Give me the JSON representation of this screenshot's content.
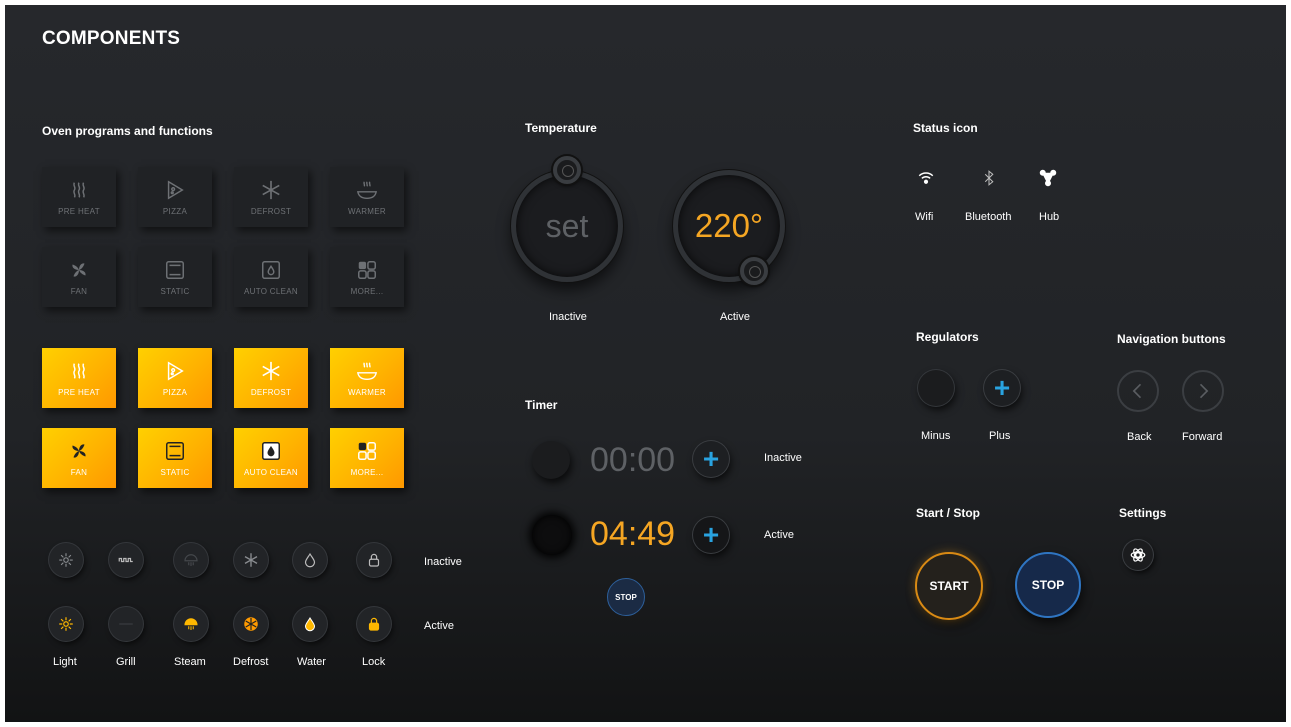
{
  "title": "COMPONENTS",
  "sections": {
    "oven": "Oven programs and functions",
    "temperature": "Temperature",
    "timer": "Timer",
    "status": "Status icon",
    "regulators": "Regulators",
    "navigation": "Navigation buttons",
    "startstop": "Start / Stop",
    "settings": "Settings"
  },
  "programs": [
    "PRE HEAT",
    "PIZZA",
    "DEFROST",
    "WARMER",
    "FAN",
    "STATIC",
    "AUTO CLEAN",
    "MORE..."
  ],
  "temperature": {
    "inactive_value": "set",
    "active_value": "220°",
    "inactive_label": "Inactive",
    "active_label": "Active"
  },
  "timer": {
    "inactive_time": "00:00",
    "active_time": "04:49",
    "inactive_label": "Inactive",
    "active_label": "Active",
    "stop_label": "STOP",
    "plus": "+"
  },
  "status": {
    "wifi": "Wifi",
    "bluetooth": "Bluetooth",
    "hub": "Hub"
  },
  "regulators": {
    "minus": "Minus",
    "plus": "Plus",
    "plus_symbol": "+"
  },
  "navigation": {
    "back": "Back",
    "forward": "Forward"
  },
  "startstop": {
    "start": "START",
    "stop": "STOP"
  },
  "round_functions": {
    "labels": [
      "Light",
      "Grill",
      "Steam",
      "Defrost",
      "Water",
      "Lock"
    ],
    "inactive_label": "Inactive",
    "active_label": "Active"
  },
  "colors": {
    "accent": "#f5a623",
    "blue": "#29a3e0",
    "gold_start": "#ffd000",
    "gold_end": "#ff9800"
  }
}
